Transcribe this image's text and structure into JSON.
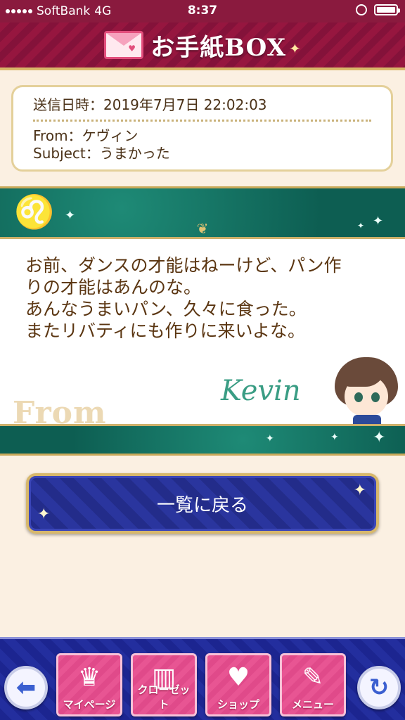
{
  "status_bar": {
    "carrier": "SoftBank",
    "network": "4G",
    "time": "8:37"
  },
  "header": {
    "title": "お手紙BOX",
    "icon": "envelope-icon"
  },
  "message_info": {
    "sent_label": "送信日時：",
    "sent_value": "2019年7月7日 22:02:03",
    "from_label": "From：",
    "from_value": "ケヴィン",
    "subject_label": "Subject：",
    "subject_value": "うまかった"
  },
  "letter": {
    "lines": [
      "お前、ダンスの才能はねーけど、パン作",
      "りの才能はあんのな。",
      "あんなうまいパン、久々に食った。",
      "またリバティにも作りに来いよな。"
    ],
    "from_watermark": "From",
    "signature": "Kevin"
  },
  "back_button": {
    "label": "一覧に戻る"
  },
  "bottom_nav": {
    "back_icon": "arrow-left-icon",
    "reload_icon": "refresh-icon",
    "items": [
      {
        "label": "マイページ",
        "icon": "tiara-icon"
      },
      {
        "label": "クローゼット",
        "icon": "closet-icon"
      },
      {
        "label": "ショップ",
        "icon": "shop-basket-icon"
      },
      {
        "label": "メニュー",
        "icon": "menu-book-icon"
      }
    ]
  },
  "colors": {
    "header_bg": "#96163f",
    "gold": "#d7b86c",
    "teal": "#0d5e52",
    "letter_text": "#5b3612",
    "button_blue": "#232c8a",
    "tile_pink": "#e85593"
  }
}
